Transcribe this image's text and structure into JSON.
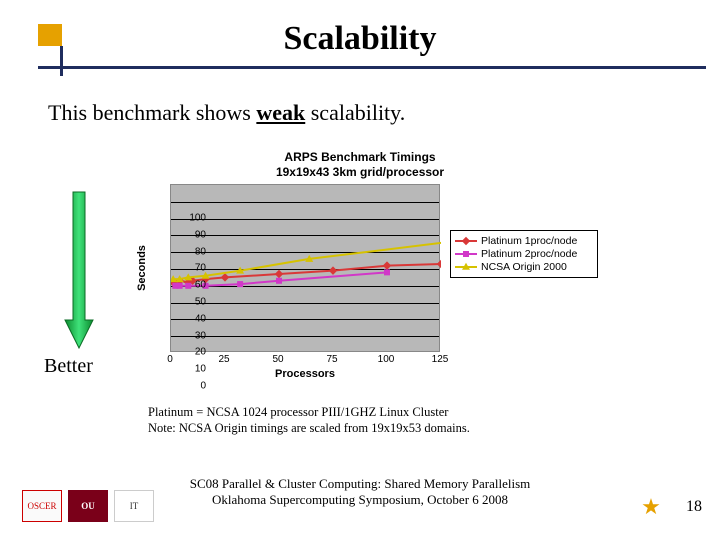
{
  "title": "Scalability",
  "body_text_prefix": "This benchmark shows ",
  "body_text_emph": "weak",
  "body_text_suffix": " scalability.",
  "better_label": "Better",
  "platinum_note_line1": "Platinum = NCSA 1024 processor PIII/1GHZ Linux Cluster",
  "platinum_note_line2": "Note: NCSA Origin timings are scaled from 19x19x53 domains.",
  "footer_line1": "SC08 Parallel & Cluster Computing: Shared Memory Parallelism",
  "footer_line2": "Oklahoma Supercomputing Symposium, October 6 2008",
  "slide_number": "18",
  "logos": {
    "left1": "OSCER",
    "left2": "OU",
    "left3": "IT",
    "right": "star-icon"
  },
  "chart_data": {
    "type": "line",
    "title_line1": "ARPS Benchmark Timings",
    "title_line2": "19x19x43 3km grid/processor",
    "xlabel": "Processors",
    "ylabel": "Seconds",
    "xlim": [
      0,
      125
    ],
    "ylim": [
      0,
      100
    ],
    "x_ticks": [
      0,
      25,
      50,
      75,
      100,
      125
    ],
    "y_ticks": [
      0,
      10,
      20,
      30,
      40,
      50,
      60,
      70,
      80,
      90,
      100
    ],
    "series": [
      {
        "name": "Platinum 1proc/node",
        "color": "#d93838",
        "marker": "diamond",
        "x": [
          1,
          4,
          8,
          10,
          16,
          25,
          50,
          75,
          100,
          125
        ],
        "y": [
          42,
          43,
          42,
          43,
          44,
          45,
          47,
          49,
          52,
          53
        ]
      },
      {
        "name": "Platinum 2proc/node",
        "color": "#d138c8",
        "marker": "square",
        "x": [
          2,
          4,
          8,
          16,
          32,
          50,
          100
        ],
        "y": [
          40,
          40,
          40,
          40,
          41,
          43,
          48
        ]
      },
      {
        "name": "NCSA Origin 2000",
        "color": "#d6c200",
        "marker": "triangle",
        "x": [
          1,
          4,
          8,
          16,
          32,
          64,
          128
        ],
        "y": [
          44,
          44,
          45,
          46,
          49,
          56,
          66
        ]
      }
    ]
  }
}
